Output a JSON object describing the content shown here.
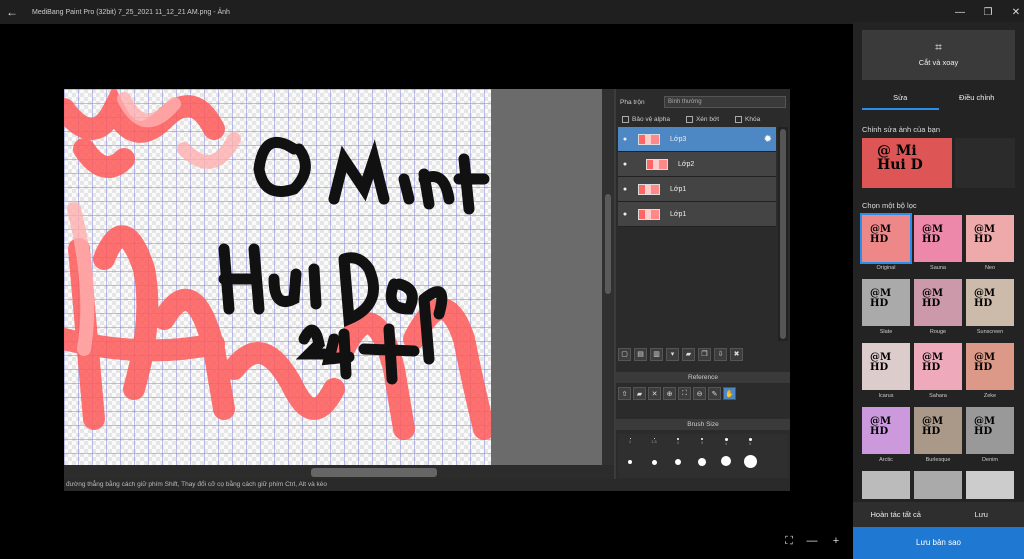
{
  "titlebar": {
    "back_icon": "back-arrow-icon",
    "title": "MediBang Paint Pro (32bit) 7_25_2021 11_12_21 AM.png - Ảnh",
    "minimize": "—",
    "restore": "❐",
    "close": "✕"
  },
  "app": {
    "status_text": "đường thẳng bằng cách giữ phím Shift, Thay đổi cỡ cọ bằng cách giữ phím Ctrl, Alt và kéo",
    "blend_label": "Pha trộn",
    "blend_value": "Bình thường",
    "checks": [
      "Bảo vệ alpha",
      "Xén bớt",
      "Khóa"
    ],
    "layers": [
      {
        "name": "Lớp3",
        "selected": true
      },
      {
        "name": "Lớp2",
        "selected": false
      },
      {
        "name": "Lớp1",
        "selected": false
      },
      {
        "name": "Lớp1",
        "selected": false
      }
    ],
    "reference_title": "Reference",
    "brush_title": "Brush Size",
    "brush_sizes": [
      "1",
      "1.5",
      "2",
      "3",
      "4",
      "5",
      "",
      ""
    ]
  },
  "side": {
    "crop_label": "Cắt và xoay",
    "tabs": [
      "Sửa",
      "Điều chỉnh"
    ],
    "enhance_title": "Chỉnh sửa ảnh của bạn",
    "filters_title": "Chọn một bộ lọc",
    "filters": [
      "Original",
      "Sauna",
      "Neo",
      "Slate",
      "Rouge",
      "Sunscreen",
      "Icarus",
      "Sahara",
      "Zeke",
      "Arctic",
      "Burlesque",
      "Denim",
      "",
      "",
      ""
    ],
    "undo_all": "Hoàn tác tất cả",
    "save": "Lưu",
    "save_copy": "Lưu bản sao"
  },
  "zoom": {
    "fit": "⛶",
    "minus": "—",
    "plus": "+"
  },
  "colors": {
    "accent": "#2b8dea",
    "layer_selected": "#4d87c4",
    "save_button": "#1f78d1"
  }
}
